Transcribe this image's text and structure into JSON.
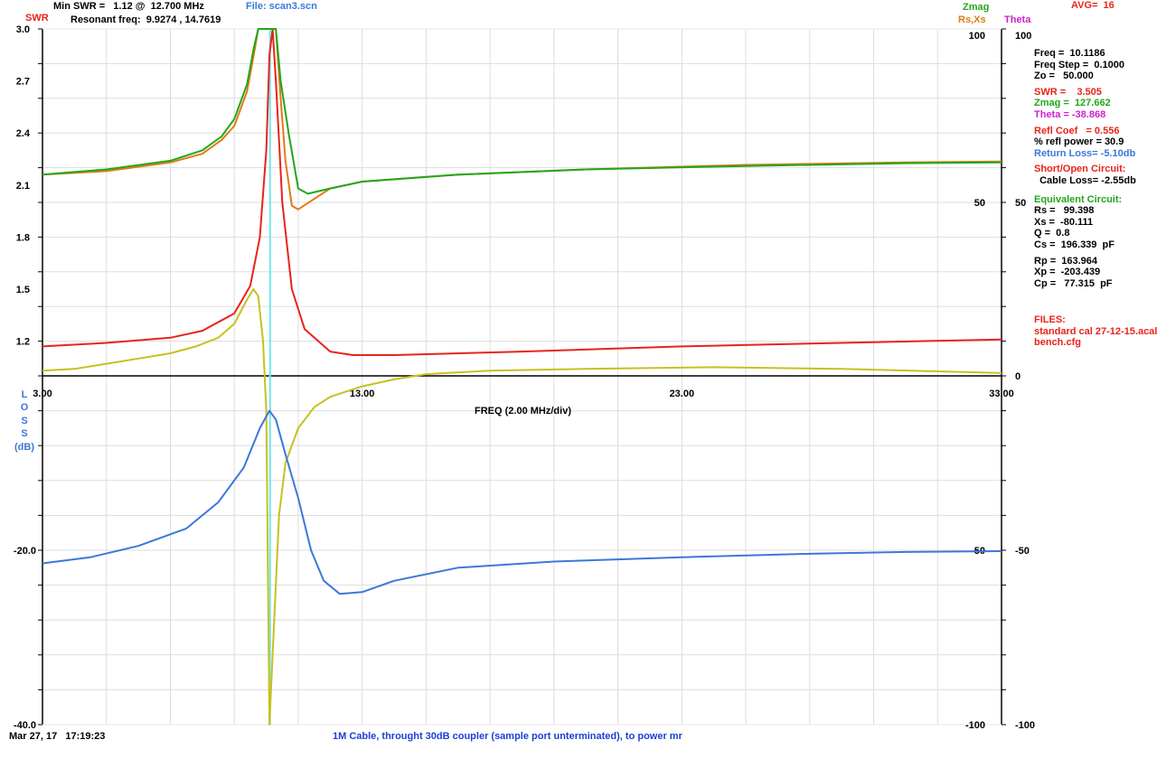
{
  "header": {
    "swr_label": "SWR",
    "min_swr": "Min SWR =   1.12 @  12.700 MHz",
    "file": "File: scan3.scn",
    "resonant": "Resonant freq:  9.9274 , 14.7619",
    "zmag_label": "Zmag",
    "rsxs_label": "Rs,Xs",
    "theta_label": "Theta",
    "avg": "AVG=  16"
  },
  "sidebar": {
    "freq": "Freq =  10.1186",
    "freq_step": "Freq Step =  0.1000",
    "zo": "Zo =   50.000",
    "swr": "SWR =    3.505",
    "zmag": "Zmag =  127.662",
    "theta": "Theta = -38.868",
    "refl_coef": "Refl Coef   = 0.556",
    "refl_power": "% refl power = 30.9",
    "return_loss": "Return Loss= -5.10db",
    "short_open": "Short/Open Circuit:",
    "cable_loss": "  Cable Loss= -2.55db",
    "equiv": "Equivalent Circuit:",
    "rs": "Rs =   99.398",
    "xs": "Xs =  -80.111",
    "q": "Q =  0.8",
    "cs": "Cs =  196.339  pF",
    "rp": "Rp =  163.964",
    "xp": "Xp =  -203.439",
    "cp": "Cp =   77.315  pF",
    "files_label": "FILES:",
    "file1": "standard cal 27-12-15.acal",
    "file2": "bench.cfg"
  },
  "footer": {
    "datetime": "Mar 27, 17   17:19:23",
    "note": "1M Cable, throught 30dB coupler (sample port unterminated), to power mr"
  },
  "loss_label": [
    "L",
    "O",
    "S",
    "S",
    "(dB)"
  ],
  "colors": {
    "swr": "#e8231a",
    "zmag": "#23a61c",
    "rs": "#e07b18",
    "xs": "#c8c020",
    "theta": "#cc22cc",
    "loss": "#3b78d8",
    "marker": "#6fe6ee",
    "grid": "#dddddd",
    "axis": "#000000"
  },
  "chart_data": {
    "type": "line",
    "xlabel": "FREQ (2.00 MHz/div)",
    "x_ticks": [
      "3.00",
      "13.00",
      "23.00",
      "33.00"
    ],
    "xlim": [
      3,
      33
    ],
    "marker_x": 10.1186,
    "top": {
      "ylabel": "SWR",
      "ylim": [
        1.0,
        3.0
      ],
      "y_ticks": [
        "3.0",
        "2.7",
        "2.4",
        "2.1",
        "1.8",
        "1.5",
        "1.2"
      ],
      "right_ticks_inner": [
        "100",
        "50"
      ],
      "right_ticks_outer": [
        "100",
        "50",
        "0"
      ],
      "right_range": [
        0,
        100
      ],
      "series": [
        {
          "name": "SWR",
          "axis": "swr",
          "color_key": "swr",
          "points": [
            [
              3,
              1.17
            ],
            [
              5,
              1.19
            ],
            [
              7,
              1.22
            ],
            [
              8,
              1.26
            ],
            [
              9,
              1.36
            ],
            [
              9.5,
              1.52
            ],
            [
              9.8,
              1.8
            ],
            [
              10.0,
              2.3
            ],
            [
              10.1,
              2.85
            ],
            [
              10.2,
              3.0
            ],
            [
              10.3,
              2.7
            ],
            [
              10.5,
              2.0
            ],
            [
              10.8,
              1.5
            ],
            [
              11.2,
              1.27
            ],
            [
              12,
              1.14
            ],
            [
              12.7,
              1.12
            ],
            [
              14,
              1.12
            ],
            [
              18,
              1.14
            ],
            [
              23,
              1.17
            ],
            [
              28,
              1.19
            ],
            [
              33,
              1.21
            ]
          ]
        },
        {
          "name": "Zmag",
          "axis": "right",
          "color_key": "zmag",
          "points": [
            [
              3,
              58
            ],
            [
              5,
              59.5
            ],
            [
              7,
              62
            ],
            [
              8,
              65
            ],
            [
              8.6,
              69
            ],
            [
              9.0,
              74
            ],
            [
              9.4,
              84
            ],
            [
              9.6,
              94
            ],
            [
              9.75,
              100
            ],
            [
              10.3,
              100
            ],
            [
              10.45,
              85
            ],
            [
              10.7,
              70
            ],
            [
              11.0,
              54
            ],
            [
              11.3,
              52.5
            ],
            [
              12,
              54
            ],
            [
              13,
              56
            ],
            [
              16,
              58
            ],
            [
              20,
              59.5
            ],
            [
              25,
              60.5
            ],
            [
              30,
              61.3
            ],
            [
              33,
              61.5
            ]
          ]
        },
        {
          "name": "Rs",
          "axis": "right",
          "color_key": "rs",
          "points": [
            [
              3,
              58
            ],
            [
              5,
              59
            ],
            [
              7,
              61.5
            ],
            [
              8,
              64
            ],
            [
              8.6,
              68
            ],
            [
              9.0,
              72
            ],
            [
              9.4,
              82
            ],
            [
              9.6,
              92
            ],
            [
              9.75,
              100
            ],
            [
              10.3,
              100
            ],
            [
              10.45,
              80
            ],
            [
              10.6,
              62
            ],
            [
              10.8,
              49
            ],
            [
              11.0,
              48
            ],
            [
              11.5,
              51
            ],
            [
              12,
              54
            ],
            [
              13,
              56
            ],
            [
              16,
              58
            ],
            [
              20,
              59.5
            ],
            [
              25,
              60.8
            ],
            [
              30,
              61.5
            ],
            [
              33,
              61.8
            ]
          ]
        },
        {
          "name": "Xs",
          "axis": "right",
          "color_key": "xs",
          "points": [
            [
              3,
              1.5
            ],
            [
              4,
              2
            ],
            [
              5,
              3.5
            ],
            [
              6,
              5
            ],
            [
              7,
              6.5
            ],
            [
              7.8,
              8.5
            ],
            [
              8.5,
              11
            ],
            [
              9.0,
              15
            ],
            [
              9.4,
              22
            ],
            [
              9.6,
              25
            ],
            [
              9.75,
              23
            ],
            [
              9.9,
              10
            ],
            [
              10.0,
              -10
            ],
            [
              10.1,
              -100
            ],
            [
              10.2,
              -80
            ],
            [
              10.4,
              -40
            ],
            [
              10.6,
              -25
            ],
            [
              11.0,
              -15
            ],
            [
              11.5,
              -9
            ],
            [
              12,
              -6
            ],
            [
              13,
              -3
            ],
            [
              14,
              -1
            ],
            [
              15,
              0.5
            ],
            [
              17,
              1.5
            ],
            [
              20,
              2
            ],
            [
              24,
              2.5
            ],
            [
              28,
              2
            ],
            [
              31,
              1.3
            ],
            [
              33,
              0.8
            ]
          ]
        }
      ]
    },
    "bottom": {
      "ylabel": "LOSS (dB)",
      "ylim": [
        -40,
        0
      ],
      "y_ticks": [
        "-20.0",
        "-40.0"
      ],
      "right_ticks_inner": [
        "-50",
        "-100"
      ],
      "right_ticks_outer": [
        "-50",
        "-100"
      ],
      "right_range": [
        -100,
        0
      ],
      "series": [
        {
          "name": "LOSS",
          "axis": "loss",
          "color_key": "loss",
          "points": [
            [
              3,
              -21.5
            ],
            [
              4.5,
              -20.8
            ],
            [
              6,
              -19.5
            ],
            [
              7.5,
              -17.5
            ],
            [
              8.5,
              -14.5
            ],
            [
              9.3,
              -10.5
            ],
            [
              9.8,
              -6
            ],
            [
              10.1,
              -4
            ],
            [
              10.3,
              -5
            ],
            [
              10.6,
              -9
            ],
            [
              11.0,
              -14
            ],
            [
              11.4,
              -20
            ],
            [
              11.8,
              -23.5
            ],
            [
              12.3,
              -25
            ],
            [
              13,
              -24.8
            ],
            [
              14,
              -23.5
            ],
            [
              16,
              -22
            ],
            [
              19,
              -21.3
            ],
            [
              23,
              -20.8
            ],
            [
              27,
              -20.4
            ],
            [
              30,
              -20.2
            ],
            [
              33,
              -20.1
            ]
          ]
        },
        {
          "name": "Xs",
          "axis": "right",
          "color_key": "xs",
          "points": [
            [
              10.1,
              -100
            ],
            [
              10.2,
              -80
            ],
            [
              10.4,
              -40
            ],
            [
              10.6,
              -25
            ],
            [
              11.0,
              -15
            ],
            [
              11.5,
              -9
            ],
            [
              12,
              -6
            ],
            [
              13,
              -3
            ],
            [
              14,
              -1
            ],
            [
              15,
              0
            ]
          ]
        }
      ]
    }
  }
}
